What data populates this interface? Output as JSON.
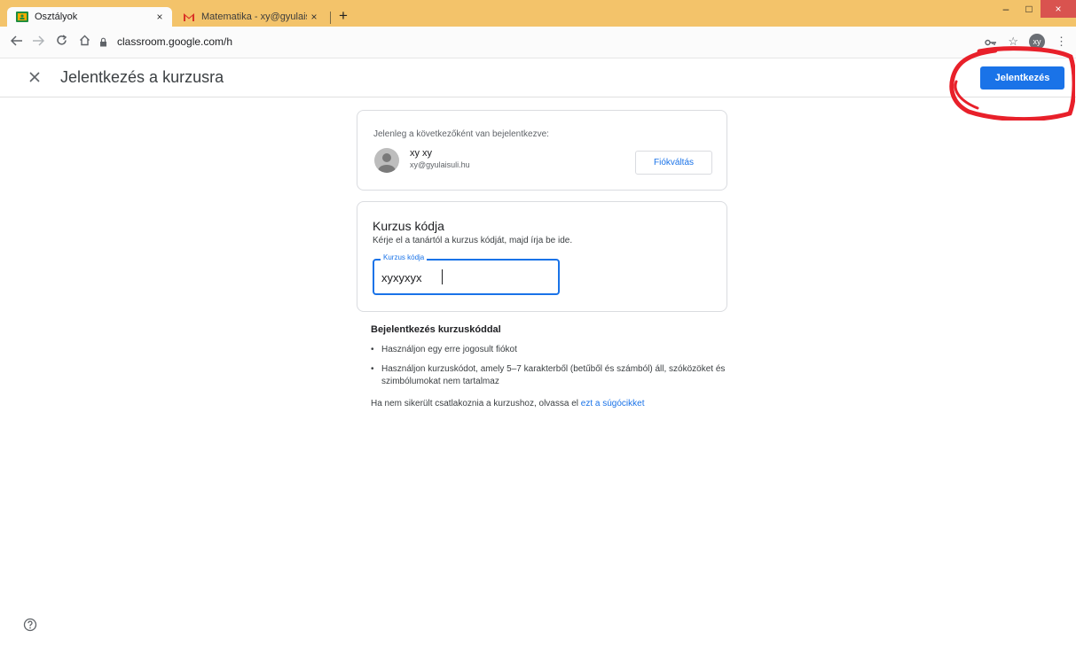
{
  "browser": {
    "tabs": [
      {
        "title": "Osztályok",
        "close": "×"
      },
      {
        "title": "Matematika - xy@gyulaisuli.hu -",
        "close": "×"
      }
    ],
    "new_tab": "+",
    "address": "classroom.google.com/h",
    "profile_initials": "xy",
    "win_min": "–",
    "win_max": "□",
    "win_close": "×"
  },
  "header": {
    "title": "Jelentkezés a kurzusra",
    "join_button": "Jelentkezés"
  },
  "account": {
    "label": "Jelenleg a következőként van bejelentkezve:",
    "name": "xy xy",
    "email": "xy@gyulaisuli.hu",
    "switch_button": "Fiókváltás"
  },
  "course_code": {
    "title": "Kurzus kódja",
    "description": "Kérje el a tanártól a kurzus kódját, majd írja be ide.",
    "field_label": "Kurzus kódja",
    "value": "xyxyxyx"
  },
  "info": {
    "heading": "Bejelentkezés kurzuskóddal",
    "bullets": [
      "Használjon egy erre jogosult fiókot",
      "Használjon kurzuskódot, amely 5–7 karakterből (betűből és számból) áll, szóközöket és szimbólumokat nem tartalmaz"
    ],
    "help_text": "Ha nem sikerült csatlakoznia a kurzushoz, olvassa el",
    "help_link": "ezt a súgócikket"
  },
  "colors": {
    "accent": "#1a73e8",
    "tabbar": "#f3c36a",
    "annotation": "#e8202a"
  }
}
